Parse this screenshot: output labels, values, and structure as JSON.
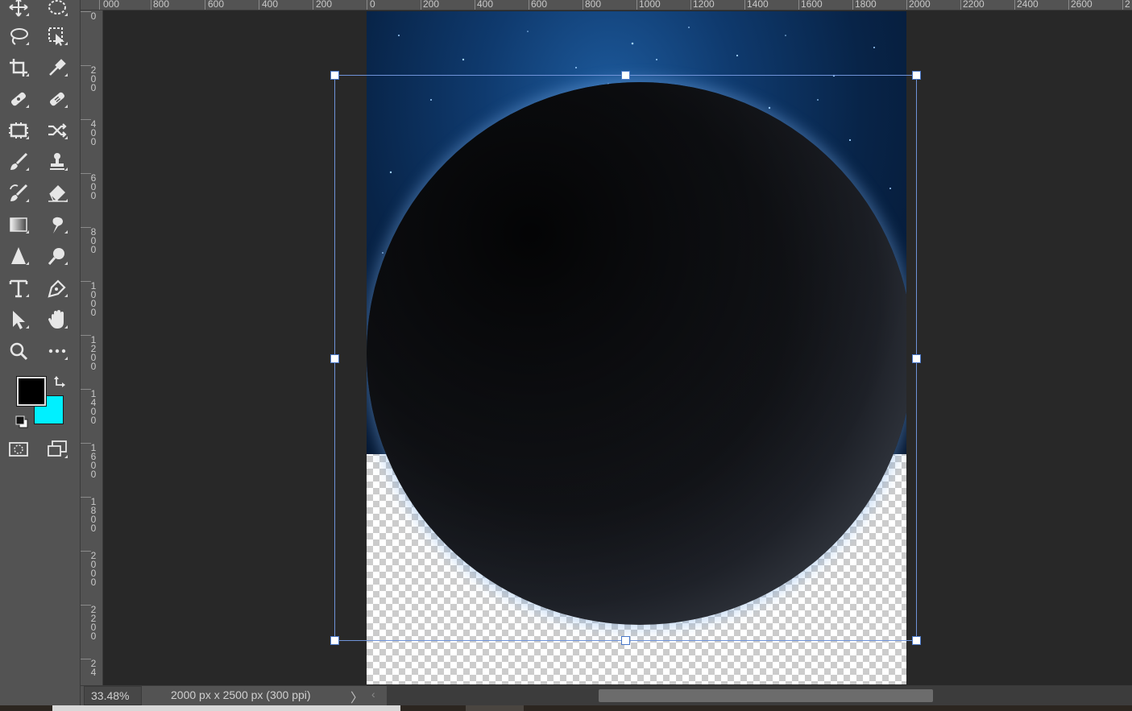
{
  "app": "Photoshop",
  "ruler": {
    "top_labels": [
      "000",
      "800",
      "600",
      "400",
      "200",
      "0",
      "200",
      "400",
      "600",
      "800",
      "1000",
      "1200",
      "1400",
      "1600",
      "1800",
      "2000",
      "2200",
      "2400",
      "2600",
      "2"
    ],
    "left_labels": [
      [
        "0"
      ],
      [
        "2",
        "0",
        "0"
      ],
      [
        "4",
        "0",
        "0"
      ],
      [
        "6",
        "0",
        "0"
      ],
      [
        "8",
        "0",
        "0"
      ],
      [
        "1",
        "0",
        "0",
        "0"
      ],
      [
        "1",
        "2",
        "0",
        "0"
      ],
      [
        "1",
        "4",
        "0",
        "0"
      ],
      [
        "1",
        "6",
        "0",
        "0"
      ],
      [
        "1",
        "8",
        "0",
        "0"
      ],
      [
        "2",
        "0",
        "0",
        "0"
      ],
      [
        "2",
        "2",
        "0",
        "0"
      ],
      [
        "2",
        "4"
      ]
    ]
  },
  "tools": [
    {
      "name": "move-tool",
      "icon": "move-icon"
    },
    {
      "name": "marquee-tool",
      "icon": "elliptical-marquee-icon"
    },
    {
      "name": "lasso-tool",
      "icon": "lasso-icon"
    },
    {
      "name": "object-selection-tool",
      "icon": "object-selection-icon"
    },
    {
      "name": "crop-tool",
      "icon": "crop-icon"
    },
    {
      "name": "eyedropper-tool",
      "icon": "eyedropper-icon"
    },
    {
      "name": "spot-healing-tool",
      "icon": "spot-healing-icon"
    },
    {
      "name": "healing-brush-tool",
      "icon": "bandage-icon"
    },
    {
      "name": "content-aware-move-tool",
      "icon": "content-aware-move-icon"
    },
    {
      "name": "red-eye-tool",
      "icon": "shuffle-icon"
    },
    {
      "name": "brush-tool",
      "icon": "brush-icon"
    },
    {
      "name": "clone-stamp-tool",
      "icon": "stamp-icon"
    },
    {
      "name": "history-brush-tool",
      "icon": "history-brush-icon"
    },
    {
      "name": "eraser-tool",
      "icon": "eraser-icon"
    },
    {
      "name": "gradient-tool",
      "icon": "gradient-icon"
    },
    {
      "name": "smudge-tool",
      "icon": "smudge-icon"
    },
    {
      "name": "sharpen-tool",
      "icon": "sharpen-icon"
    },
    {
      "name": "dodge-tool",
      "icon": "dodge-icon"
    },
    {
      "name": "type-tool",
      "icon": "type-icon"
    },
    {
      "name": "pen-tool",
      "icon": "pen-icon"
    },
    {
      "name": "path-selection-tool",
      "icon": "arrow-cursor-icon"
    },
    {
      "name": "hand-tool",
      "icon": "hand-icon"
    },
    {
      "name": "zoom-tool",
      "icon": "zoom-icon"
    },
    {
      "name": "more-tools",
      "icon": "ellipsis-icon"
    },
    {
      "name": "quick-mask-button",
      "icon": "quick-mask-icon"
    },
    {
      "name": "screen-mode-button",
      "icon": "screen-mode-icon"
    }
  ],
  "colors": {
    "foreground": "#000000",
    "background": "#00f0ff",
    "accent": "#6f93d8"
  },
  "status": {
    "zoom": "33.48%",
    "doc_info": "2000 px x 2500 px (300 ppi)",
    "info_arrow": "〉",
    "scroll_left": "‹"
  }
}
